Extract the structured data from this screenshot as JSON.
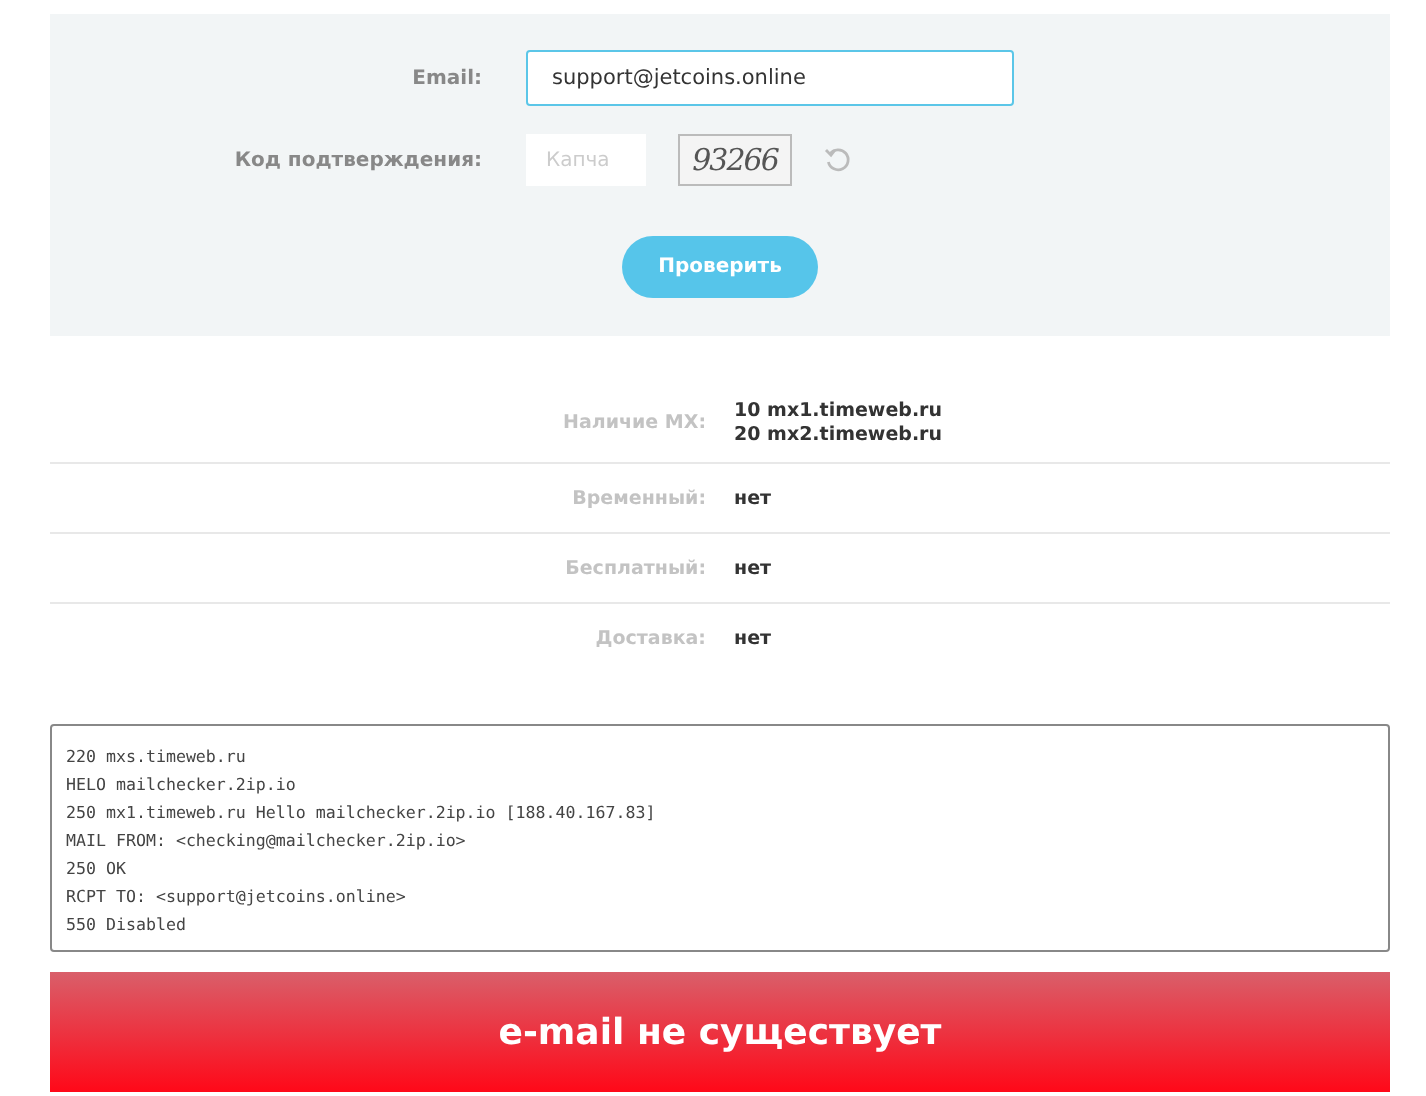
{
  "form": {
    "email_label": "Email:",
    "email_value": "support@jetcoins.online",
    "code_label": "Код подтверждения:",
    "captcha_placeholder": "Капча",
    "captcha_image_text": "93266",
    "submit": "Проверить"
  },
  "results": [
    {
      "label": "Наличие MX:",
      "values": [
        "**10** mx1.timeweb.ru",
        "**20** mx2.timeweb.ru"
      ]
    },
    {
      "label": "Временный:",
      "values": [
        "нет"
      ]
    },
    {
      "label": "Бесплатный:",
      "values": [
        "нет"
      ]
    },
    {
      "label": "Доставка:",
      "values": [
        "нет"
      ]
    }
  ],
  "log": [
    "220 mxs.timeweb.ru",
    "HELO mailchecker.2ip.io",
    "250 mx1.timeweb.ru Hello mailchecker.2ip.io [188.40.167.83]",
    "MAIL FROM: <checking@mailchecker.2ip.io>",
    "250 OK",
    "RCPT TO: <support@jetcoins.online>",
    "550 Disabled"
  ],
  "verdict": "e-mail не существует"
}
